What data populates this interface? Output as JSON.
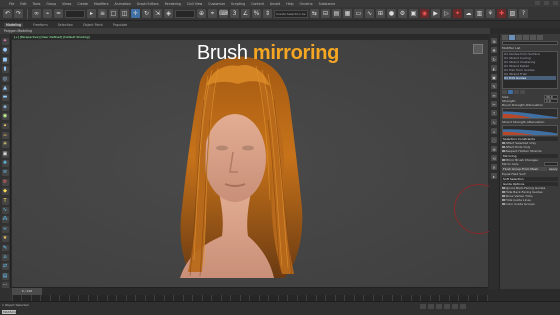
{
  "menu": {
    "items": [
      "File",
      "Edit",
      "Tools",
      "Group",
      "Views",
      "Create",
      "Modifiers",
      "Animation",
      "Graph Editors",
      "Rendering",
      "Civil View",
      "Customize",
      "Scripting",
      "Content",
      "Arnold",
      "Help",
      "Ornatrix",
      "Substance"
    ]
  },
  "toolbar": {
    "selection_set": "Create Selection Se"
  },
  "ribbon": {
    "tabs": [
      "Modeling",
      "Freeform",
      "Selection",
      "Object Paint",
      "Populate"
    ],
    "active_tab": "Modeling",
    "section_label": "Polygon Modeling"
  },
  "viewport": {
    "label": "[+] [Perspective] [User Defined] [Default Shading]",
    "title_plain": "Brush ",
    "title_highlight": "mirroring",
    "accent_color": "#f5a623"
  },
  "panel": {
    "modifier_list": "Modifier List",
    "stack": [
      "Ox Guides from Surface",
      "Ox Strand Curling",
      "Ox Strand Clustering",
      "Ox Strand Detail",
      "Ox Hair from Guides",
      "Ox Strand Frizz",
      "Ox Edit Guides"
    ],
    "size_label": "Size:",
    "size_value": "39.0",
    "strength_label": "Strength:",
    "strength_value": "1.0",
    "brush_attenuation": "Brush Strength Attenuation",
    "strand_attenuation": "Strand Strength Attenuation",
    "selection_constraints": "Selection Constraints",
    "affect_selected": "Affect Selected Only",
    "affect_ends": "Affect Ends Only",
    "respect_hidden": "Respect Hidden Strands",
    "mirroring": "Mirroring",
    "mirror_brush": "Mirror Brush Changes",
    "mirror_axis": "Mirror Axis:",
    "flush_label": "Flush Group From Mesh",
    "apply_label": "Apply",
    "equal_label": "Equal Field Surf:",
    "soft_selection": "Soft Selection",
    "guide_options": "Guide Options",
    "ignore_back": "Ignore Back-Facing Guides",
    "hide_back": "Hide Back-Facing Guides",
    "show_vertex": "Show Vertex Ticks",
    "hide_guide_lines": "Hide Guide Lines",
    "color_guide": "Color Guide Groups"
  },
  "timeline": {
    "frame_indicator": "0 / 100"
  },
  "status": {
    "text": "1 Object Selected",
    "script_label": "MAXScript"
  }
}
